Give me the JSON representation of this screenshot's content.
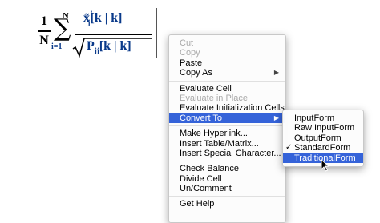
{
  "formula": {
    "one": "1",
    "big_n": "N",
    "sum_upper": "N",
    "sum_lower": "i=1",
    "num_main": "x̃",
    "num_super": "i",
    "num_sub": "j",
    "num_args": "[k | k]",
    "den_main": "P",
    "den_sub": "jj",
    "den_args": "[k | k]"
  },
  "context_menu": {
    "items": [
      {
        "label": "Cut",
        "state": "disabled"
      },
      {
        "label": "Copy",
        "state": "disabled"
      },
      {
        "label": "Paste",
        "state": "enabled"
      },
      {
        "label": "Copy As",
        "state": "enabled",
        "submenu": true
      },
      {
        "label": "Evaluate Cell",
        "state": "enabled"
      },
      {
        "label": "Evaluate in Place",
        "state": "disabled"
      },
      {
        "label": "Evaluate Initialization Cells",
        "state": "enabled"
      },
      {
        "label": "Convert To",
        "state": "highlighted",
        "submenu": true
      },
      {
        "label": "Make Hyperlink...",
        "state": "enabled"
      },
      {
        "label": "Insert Table/Matrix...",
        "state": "enabled"
      },
      {
        "label": "Insert Special Character...",
        "state": "enabled"
      },
      {
        "label": "Check Balance",
        "state": "enabled"
      },
      {
        "label": "Divide Cell",
        "state": "enabled"
      },
      {
        "label": "Un/Comment",
        "state": "enabled"
      },
      {
        "label": "Get Help",
        "state": "enabled"
      }
    ],
    "arrow": "▶"
  },
  "convert_submenu": {
    "items": [
      {
        "label": "InputForm",
        "checked": false
      },
      {
        "label": "Raw InputForm",
        "checked": false
      },
      {
        "label": "OutputForm",
        "checked": false
      },
      {
        "label": "StandardForm",
        "checked": true
      },
      {
        "label": "TraditionalForm",
        "checked": false,
        "highlighted": true
      }
    ],
    "checkmark": "✓"
  },
  "colors": {
    "highlight": "#3563d9",
    "formula_blue": "#0a3a8a",
    "disabled_text": "#a9a9a9"
  }
}
